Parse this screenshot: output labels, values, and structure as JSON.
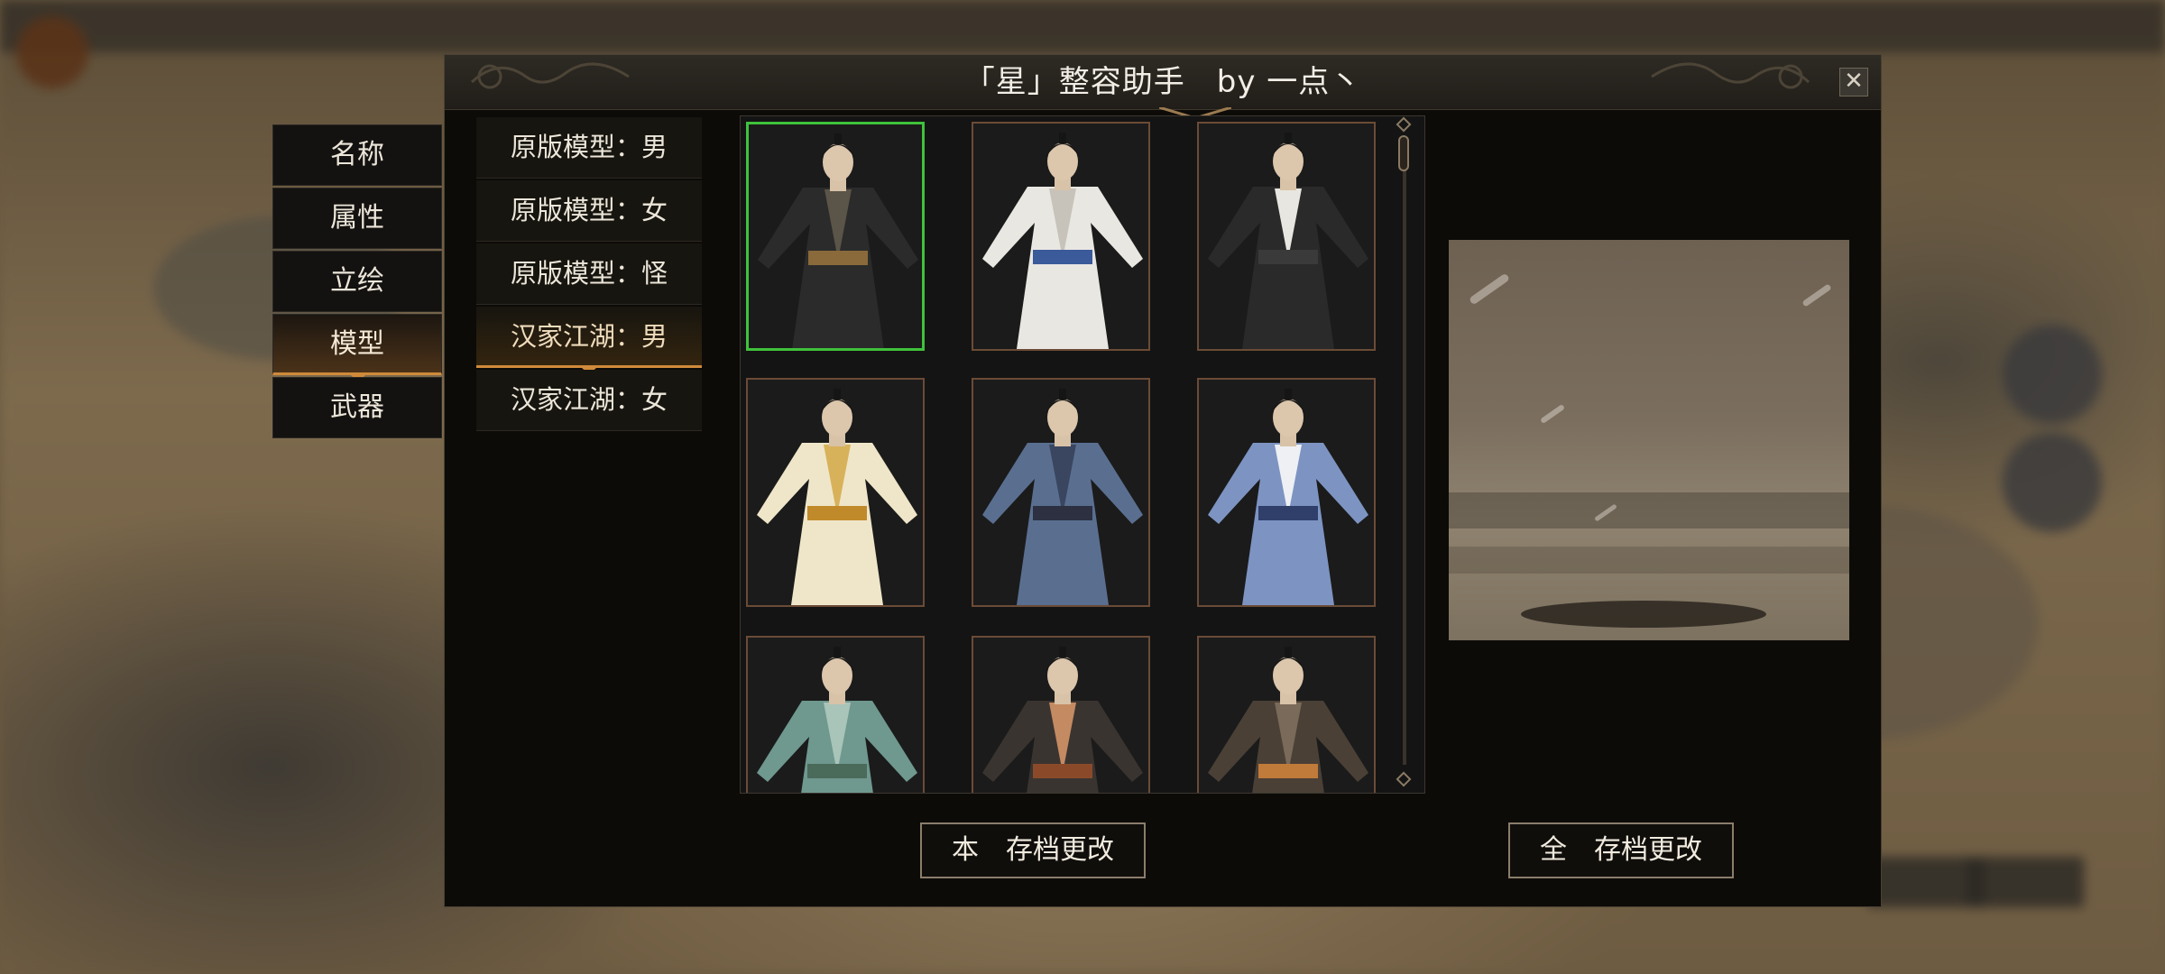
{
  "dialog": {
    "title": "「星」整容助手　by 一点丶",
    "close_label": "✕"
  },
  "categories": [
    {
      "label": "名称",
      "active": false
    },
    {
      "label": "属性",
      "active": false
    },
    {
      "label": "立绘",
      "active": false
    },
    {
      "label": "模型",
      "active": true
    },
    {
      "label": "武器",
      "active": false
    }
  ],
  "model_sources": [
    {
      "label": "原版模型：男",
      "active": false
    },
    {
      "label": "原版模型：女",
      "active": false
    },
    {
      "label": "原版模型：怪",
      "active": false
    },
    {
      "label": "汉家江湖：男",
      "active": true
    },
    {
      "label": "汉家江湖：女",
      "active": false
    }
  ],
  "models": [
    {
      "robe": "#2b2b2b",
      "accent": "#5b5448",
      "sash": "#8a6a3a",
      "selected": true
    },
    {
      "robe": "#e9e7e2",
      "accent": "#c7c3bb",
      "sash": "#3a5a9a",
      "selected": false
    },
    {
      "robe": "#2a2a2a",
      "accent": "#e8e6e0",
      "sash": "#3a3a3a",
      "selected": false
    },
    {
      "robe": "#efe6c9",
      "accent": "#d8b25a",
      "sash": "#c08a2a",
      "selected": false
    },
    {
      "robe": "#5a6f90",
      "accent": "#3a4660",
      "sash": "#2c3040",
      "selected": false
    },
    {
      "robe": "#7d94c2",
      "accent": "#eef0f4",
      "sash": "#2f3f6a",
      "selected": false
    },
    {
      "robe": "#6f988f",
      "accent": "#a9c4b8",
      "sash": "#4a6a5a",
      "selected": false
    },
    {
      "robe": "#3a3430",
      "accent": "#c48a62",
      "sash": "#8a4a2a",
      "selected": false
    },
    {
      "robe": "#4a4036",
      "accent": "#7a6a5a",
      "sash": "#c07a3a",
      "selected": false
    }
  ],
  "buttons": {
    "save_current": "本　存档更改",
    "save_all": "全　存档更改"
  }
}
